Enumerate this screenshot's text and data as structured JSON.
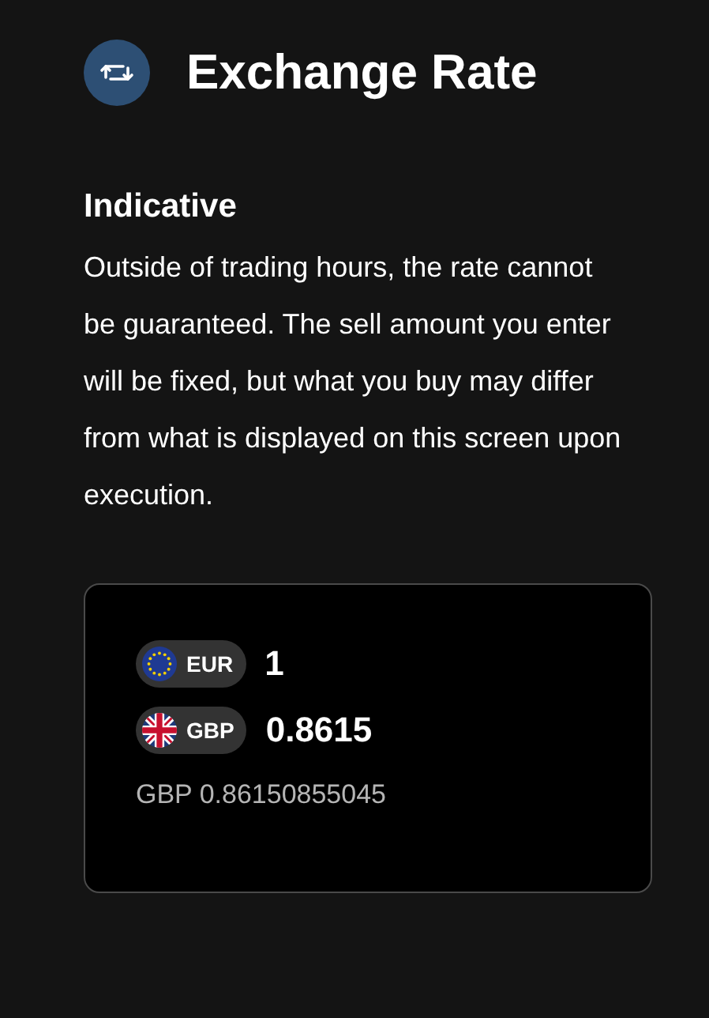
{
  "header": {
    "title": "Exchange Rate"
  },
  "notice": {
    "heading": "Indicative",
    "text": "Outside of trading hours, the rate cannot be guaranteed. The sell amount you enter will be fixed, but what you buy may differ from what is displayed on this screen upon execution."
  },
  "quote": {
    "rows": [
      {
        "kind": "eu",
        "currency": "EUR",
        "amount": "1"
      },
      {
        "kind": "gb",
        "currency": "GBP",
        "amount": "0.8615"
      }
    ],
    "precise_rate": "GBP 0.86150855045"
  }
}
